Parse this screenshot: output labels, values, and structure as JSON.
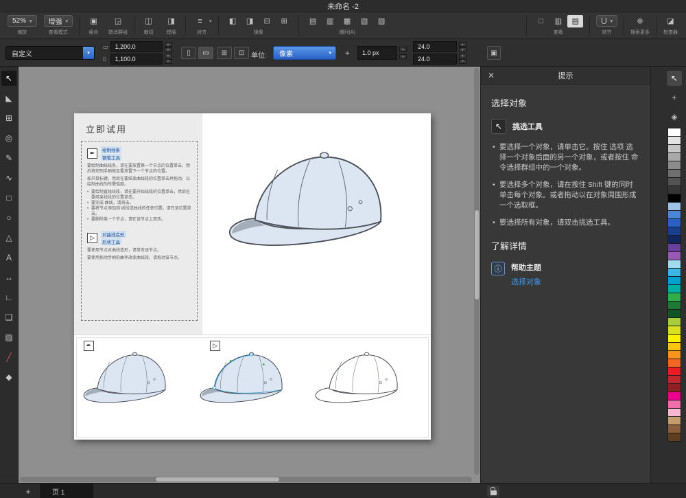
{
  "window": {
    "title": "未命名 -2"
  },
  "icons": {
    "caret": "▾",
    "caret_up": "▴",
    "close": "✕"
  },
  "toolbar": {
    "zoom": {
      "value": "52%",
      "label": "缩放"
    },
    "viewmode": {
      "value": "增强",
      "label": "查看模式"
    },
    "combine": {
      "glyph": "▣",
      "label": "组合"
    },
    "ungroup": {
      "glyph": "◲",
      "label": "取消群组"
    },
    "trim": {
      "glyph": "◫",
      "label": "裁切"
    },
    "weld": {
      "glyph": "◨",
      "label": "焊接"
    },
    "align": {
      "glyph": "≡",
      "label": "对齐"
    },
    "mirror": {
      "label": "镜像",
      "glyphs": [
        "◧",
        "◨",
        "⊟",
        "⊞"
      ]
    },
    "arrange": {
      "label": "栅列(A)",
      "glyphs": [
        "▤",
        "▥",
        "▦",
        "▧",
        "▨"
      ]
    },
    "view": {
      "label": "查看",
      "glyphs": [
        "□",
        "▥",
        "▤"
      ],
      "active_index": 2
    },
    "snap": {
      "glyph": "⋃",
      "label": "贴齐"
    },
    "more": {
      "glyph": "⊕",
      "label": "搜索更多"
    },
    "inspector": {
      "glyph": "◪",
      "label": "检查器"
    }
  },
  "propbar": {
    "preset": "自定义",
    "page_width": "1,200.0",
    "page_height": "1,100.0",
    "units_label": "单位:",
    "units_value": "像素",
    "nudge_value": "1.0 px",
    "dup_x": "24.0",
    "dup_y": "24.0"
  },
  "toolbox": [
    {
      "name": "pick-tool-icon",
      "glyph": "↖",
      "active": true
    },
    {
      "name": "shape-tool-icon",
      "glyph": "◣"
    },
    {
      "name": "crop-tool-icon",
      "glyph": "⊞"
    },
    {
      "name": "zoom-tool-icon",
      "glyph": "◎"
    },
    {
      "name": "curve-tool-icon",
      "glyph": "✎"
    },
    {
      "name": "artistic-media-tool-icon",
      "glyph": "∿"
    },
    {
      "name": "rectangle-tool-icon",
      "glyph": "□"
    },
    {
      "name": "ellipse-tool-icon",
      "glyph": "○"
    },
    {
      "name": "polygon-tool-icon",
      "glyph": "△"
    },
    {
      "name": "text-tool-icon",
      "glyph": "A"
    },
    {
      "name": "dimension-tool-icon",
      "glyph": "↔"
    },
    {
      "name": "connector-tool-icon",
      "glyph": "∟"
    },
    {
      "name": "shadow-tool-icon",
      "glyph": "❏"
    },
    {
      "name": "transparency-tool-icon",
      "glyph": "▨"
    },
    {
      "name": "eyedropper-tool-icon",
      "glyph": "╱",
      "color": "#d06060"
    },
    {
      "name": "interactive-fill-tool-icon",
      "glyph": "◆",
      "color": "#c8c8c8"
    }
  ],
  "tutorial": {
    "title": "立即试用",
    "pen_label1": "绘制线条",
    "pen_label2": "钢笔工具",
    "pen_paras": [
      "要绘制曲线线条，请在要放置第一个节点的位置单击，然后将控制手柄拖至要放置下一个节点的位置。",
      "松开鼠标键，然后在要结束曲线段的位置单击并拖动，以绘制曲线的所需弧度。"
    ],
    "pen_bullets": [
      "要绘制直线线段，请在要开始线段的位置单击，然后在要结束线段的位置单击。",
      "要完成 曲线，请双击。",
      "要将节点添加到 线段或曲线的任意位置，请在该位置单击。",
      "要删除某一个节点，请在该节点上双击。"
    ],
    "shape_label1": "对曲线造形",
    "shape_label2": "形状工具",
    "shape_paras": [
      "要使用节点对曲线造形，请单击该节点。",
      "要使用拖动手柄的曲率改变曲线段，请拖动该节点。"
    ]
  },
  "hints": {
    "title": "提示",
    "section1": "选择对象",
    "tool_name": "挑选工具",
    "bullets": [
      "要选择一个对象，请单击它。按住 选项 选择一个对象后面的另一个对象，或者按住 命令选择群组中的一个对象。",
      "要选择多个对象，请在按住 Shift 键的同时单击每个对象。或者拖动以在对象周围形成一个选取框。",
      "要选择所有对象，请双击挑选工具。"
    ],
    "section2": "了解详情",
    "info_glyph": "ⓘ",
    "help_topic": "帮助主题",
    "help_link": "选择对象"
  },
  "docker": {
    "icons": [
      {
        "name": "hints-docker-icon",
        "glyph": "↖",
        "active": true
      },
      {
        "name": "transform-docker-icon",
        "glyph": "+"
      },
      {
        "name": "styles-docker-icon",
        "glyph": "◈"
      }
    ]
  },
  "palette": {
    "colors": [
      "#ffffff",
      "#e3e3e3",
      "#c6c6c6",
      "#a9a9a9",
      "#8c8c8c",
      "#6f6f6f",
      "#525252",
      "#353535",
      "#000000",
      "#9dc3e6",
      "#4a86d8",
      "#2a5fc4",
      "#1b3f8f",
      "#12265e",
      "#6a3fa0",
      "#9b59b6",
      "#9fdcf0",
      "#3db5e6",
      "#00a0d2",
      "#00b0a0",
      "#2fae4a",
      "#1d7a34",
      "#0f5423",
      "#a6ce39",
      "#d9e021",
      "#fff200",
      "#ffc20e",
      "#f7941d",
      "#f26522",
      "#ed1c24",
      "#c1272d",
      "#8e1f24",
      "#ec008c",
      "#f06eaa",
      "#f9b8d0",
      "#c69c6d",
      "#8a5d3b",
      "#5f3d1e"
    ]
  },
  "statusbar": {
    "add_page": "+",
    "page_tab": "页 1"
  },
  "colors": {
    "accent": "#2f6fd0",
    "link": "#3f9bf0",
    "canvas_bg": "#8f8f8f",
    "cap_fill": "#dce6f2"
  }
}
